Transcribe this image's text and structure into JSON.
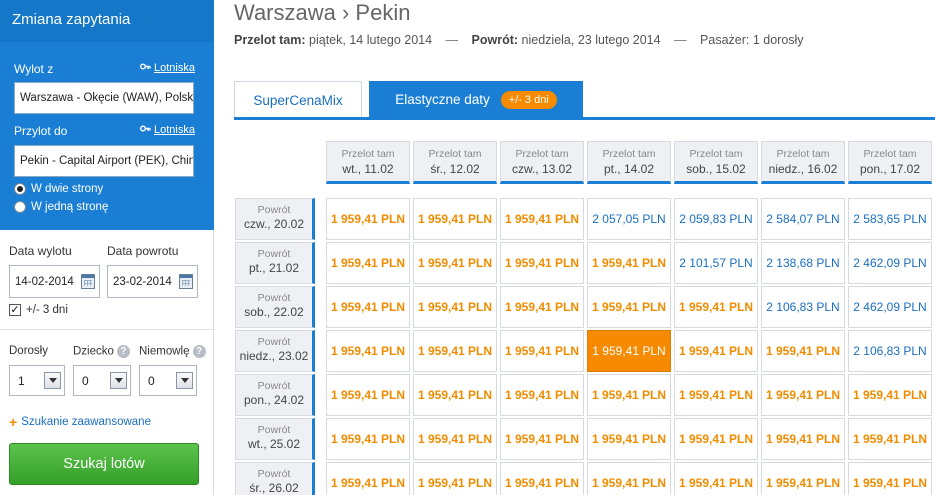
{
  "sidebar": {
    "header": "Zmiana zapytania",
    "from_label": "Wylot z",
    "airports_link": "Lotniska",
    "from_value": "Warszawa - Okęcie (WAW), Polska",
    "to_label": "Przylot do",
    "to_value": "Pekin - Capital Airport (PEK), Chiny",
    "trip_options": [
      "W dwie strony",
      "W jedną stronę"
    ],
    "depart_label": "Data wylotu",
    "return_label": "Data powrotu",
    "depart_value": "14-02-2014",
    "return_value": "23-02-2014",
    "flex_label": "+/- 3 dni",
    "adults_label": "Dorosły",
    "child_label": "Dziecko",
    "infant_label": "Niemowlę",
    "adults_value": "1",
    "child_value": "0",
    "infant_value": "0",
    "help_glyph": "?",
    "check_glyph": "✓",
    "advanced_link": "Szukanie zaawansowane",
    "search_button": "Szukaj lotów"
  },
  "header": {
    "title": "Warszawa › Pekin",
    "out_label": "Przelot tam:",
    "out_value": "piątek, 14 lutego 2014",
    "ret_label": "Powrót:",
    "ret_value": "niedziela, 23 lutego 2014",
    "pax": "Pasażer: 1 dorosły",
    "dash": "—"
  },
  "tabs": {
    "tab1": "SuperCenaMix",
    "tab2": "Elastyczne daty",
    "tab2_badge": "+/- 3 dni"
  },
  "grid": {
    "col_prefix": "Przelot tam",
    "row_prefix": "Powrót",
    "columns": [
      "wt., 11.02",
      "śr., 12.02",
      "czw., 13.02",
      "pt., 14.02",
      "sob., 15.02",
      "niedz., 16.02",
      "pon., 17.02"
    ],
    "rows": [
      {
        "date": "czw., 20.02",
        "cells": [
          "1 959,41 PLN",
          "1 959,41 PLN",
          "1 959,41 PLN",
          "2 057,05 PLN",
          "2 059,83 PLN",
          "2 584,07 PLN",
          "2 583,65 PLN"
        ]
      },
      {
        "date": "pt., 21.02",
        "cells": [
          "1 959,41 PLN",
          "1 959,41 PLN",
          "1 959,41 PLN",
          "1 959,41 PLN",
          "2 101,57 PLN",
          "2 138,68 PLN",
          "2 462,09 PLN"
        ]
      },
      {
        "date": "sob., 22.02",
        "cells": [
          "1 959,41 PLN",
          "1 959,41 PLN",
          "1 959,41 PLN",
          "1 959,41 PLN",
          "1 959,41 PLN",
          "2 106,83 PLN",
          "2 462,09 PLN"
        ]
      },
      {
        "date": "niedz., 23.02",
        "cells": [
          "1 959,41 PLN",
          "1 959,41 PLN",
          "1 959,41 PLN",
          "1 959,41 PLN",
          "1 959,41 PLN",
          "1 959,41 PLN",
          "2 106,83 PLN"
        ]
      },
      {
        "date": "pon., 24.02",
        "cells": [
          "1 959,41 PLN",
          "1 959,41 PLN",
          "1 959,41 PLN",
          "1 959,41 PLN",
          "1 959,41 PLN",
          "1 959,41 PLN",
          "1 959,41 PLN"
        ]
      },
      {
        "date": "wt., 25.02",
        "cells": [
          "1 959,41 PLN",
          "1 959,41 PLN",
          "1 959,41 PLN",
          "1 959,41 PLN",
          "1 959,41 PLN",
          "1 959,41 PLN",
          "1 959,41 PLN"
        ]
      },
      {
        "date": "śr., 26.02",
        "cells": [
          "1 959,41 PLN",
          "1 959,41 PLN",
          "1 959,41 PLN",
          "1 959,41 PLN",
          "1 959,41 PLN",
          "1 959,41 PLN",
          "1 959,41 PLN"
        ]
      }
    ],
    "lowest_price": "1 959,41 PLN",
    "selected": {
      "row": 3,
      "col": 3
    },
    "colors": {
      "cheap": "#f08c00",
      "normal": "#1a6fc0",
      "selected_bg": "#f68a00",
      "accent": "#1a7fd4"
    }
  }
}
